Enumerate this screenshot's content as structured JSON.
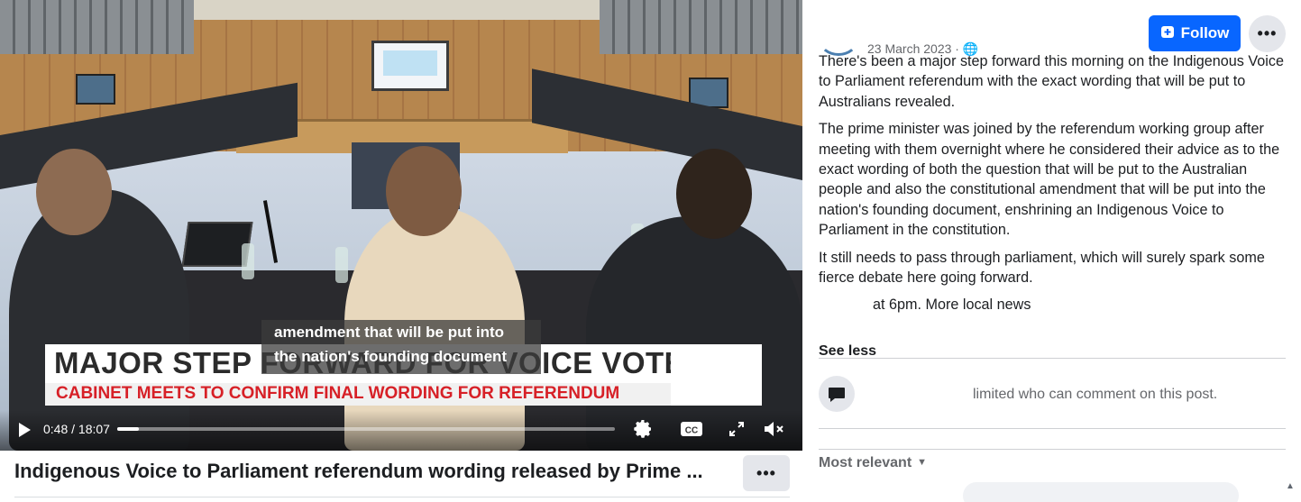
{
  "video": {
    "lower_third": {
      "headline": "MAJOR STEP FORWARD FOR VOICE VOTE",
      "subline": "CABINET MEETS TO CONFIRM FINAL WORDING FOR REFERENDUM"
    },
    "captions": [
      "amendment that will be put into",
      "the nation's founding document"
    ],
    "controls": {
      "time": "0:48 / 18:07",
      "progress": 0.0443
    },
    "icons": {
      "play": "play-icon",
      "settings": "gear-icon",
      "captions": "cc-icon",
      "fullscreen": "expand-icon",
      "volume": "muted-icon"
    }
  },
  "title": {
    "text": "Indigenous Voice to Parliament referendum wording released by Prime ...",
    "more_label": "•••"
  },
  "post": {
    "date": "23 March 2023 · ",
    "follow_label": "Follow",
    "more_label": "•••",
    "paragraphs": [
      "There's been a major step forward this morning on the Indigenous Voice to Parliament referendum with the exact wording that will be put to Australians revealed.",
      "The prime minister was joined by the referendum working group after meeting with them overnight where he considered their advice as to the exact wording of both the question that will be put to the Australian people and also the constitutional amendment that will be put into the nation's founding document, enshrining an Indigenous Voice to Parliament in the constitution.",
      "It still needs to pass through parliament, which will surely spark some fierce debate here going forward.",
      "at 6pm. More local news"
    ],
    "see_less": "See less",
    "comment_notice": "limited who can comment on this post.",
    "sort_label": "Most relevant"
  },
  "colors": {
    "follow_bg": "#0866ff",
    "lower_third_red": "#d72027"
  }
}
